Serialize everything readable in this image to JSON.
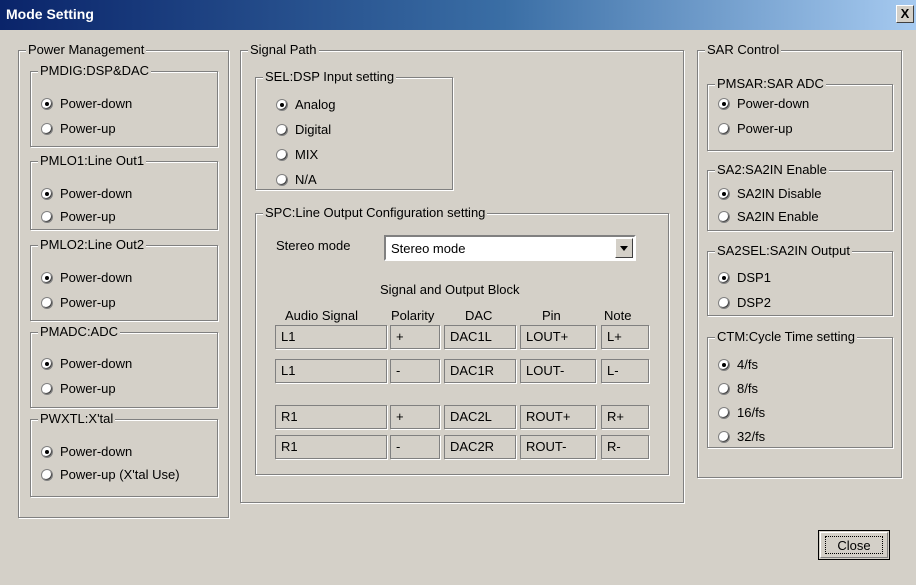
{
  "window": {
    "title": "Mode Setting",
    "close_glyph": "X"
  },
  "power_management": {
    "title": "Power Management",
    "groups": [
      {
        "title": "PMDIG:DSP&DAC",
        "options": [
          "Power-down",
          "Power-up"
        ],
        "selected": 0
      },
      {
        "title": "PMLO1:Line Out1",
        "options": [
          "Power-down",
          "Power-up"
        ],
        "selected": 0
      },
      {
        "title": "PMLO2:Line Out2",
        "options": [
          "Power-down",
          "Power-up"
        ],
        "selected": 0
      },
      {
        "title": "PMADC:ADC",
        "options": [
          "Power-down",
          "Power-up"
        ],
        "selected": 0
      },
      {
        "title": "PWXTL:X'tal",
        "options": [
          "Power-down",
          "Power-up (X'tal Use)"
        ],
        "selected": 0
      }
    ]
  },
  "signal_path": {
    "title": "Signal Path",
    "sel": {
      "title": "SEL:DSP Input setting",
      "options": [
        "Analog",
        "Digital",
        "MIX",
        "N/A"
      ],
      "selected": 0
    },
    "spc": {
      "title": "SPC:Line Output Configuration setting",
      "stereo_label": "Stereo mode",
      "stereo_value": "Stereo mode",
      "block_title": "Signal and Output Block",
      "headers": [
        "Audio Signal",
        "Polarity",
        "DAC",
        "Pin",
        "Note"
      ],
      "rows": [
        [
          "L1",
          "+",
          "DAC1L",
          "LOUT+",
          "L+"
        ],
        [
          "L1",
          "-",
          "DAC1R",
          "LOUT-",
          "L-"
        ],
        [
          "R1",
          "+",
          "DAC2L",
          "ROUT+",
          "R+"
        ],
        [
          "R1",
          "-",
          "DAC2R",
          "ROUT-",
          "R-"
        ]
      ]
    }
  },
  "sar_control": {
    "title": "SAR Control",
    "groups": [
      {
        "title": "PMSAR:SAR ADC",
        "options": [
          "Power-down",
          "Power-up"
        ],
        "selected": 0
      },
      {
        "title": "SA2:SA2IN Enable",
        "options": [
          "SA2IN Disable",
          "SA2IN Enable"
        ],
        "selected": 0
      },
      {
        "title": "SA2SEL:SA2IN Output",
        "options": [
          "DSP1",
          "DSP2"
        ],
        "selected": 0
      },
      {
        "title": "CTM:Cycle Time setting",
        "options": [
          "4/fs",
          "8/fs",
          "16/fs",
          "32/fs"
        ],
        "selected": 0
      }
    ]
  },
  "buttons": {
    "close_label": "Close"
  },
  "icons": {
    "close": "close-icon",
    "dropdown": "chevron-down-icon",
    "radio": "radio-button-icon"
  }
}
